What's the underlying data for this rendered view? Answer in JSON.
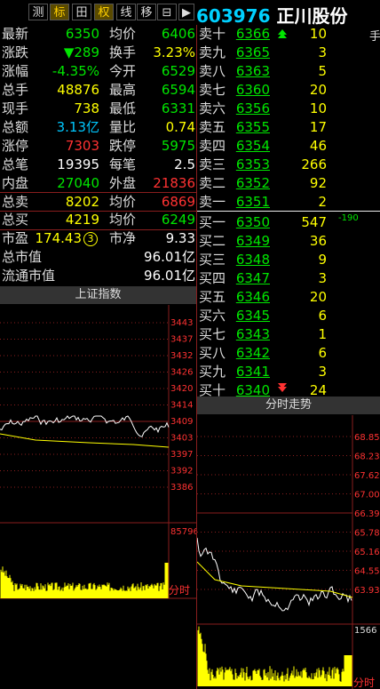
{
  "toolbar": {
    "buttons": [
      {
        "label": "测",
        "name": "tab-ce"
      },
      {
        "label": "标",
        "name": "tab-biao"
      },
      {
        "label": "田",
        "name": "tab-grid"
      },
      {
        "label": "权",
        "name": "tab-quan"
      },
      {
        "label": "线",
        "name": "tab-xian"
      },
      {
        "label": "移",
        "name": "tab-yi"
      },
      {
        "label": "⊟",
        "name": "tab-box"
      },
      {
        "label": "▶",
        "name": "tab-play"
      }
    ],
    "stock_code": "603976",
    "stock_name": "正川股份"
  },
  "quote": {
    "zuixin": {
      "label": "最新",
      "value": "6350"
    },
    "junjia": {
      "label": "均价",
      "value": "6406"
    },
    "zhangdie": {
      "label": "涨跌",
      "value": "▼289"
    },
    "huanshou": {
      "label": "换手",
      "value": "3.23%"
    },
    "zhangfu": {
      "label": "涨幅",
      "value": "-4.35%"
    },
    "jinkai": {
      "label": "今开",
      "value": "6529"
    },
    "zongshou": {
      "label": "总手",
      "value": "48876"
    },
    "zuigao": {
      "label": "最高",
      "value": "6594"
    },
    "xianshou": {
      "label": "现手",
      "value": "738"
    },
    "zuidi": {
      "label": "最低",
      "value": "6331"
    },
    "zonge": {
      "label": "总额",
      "value": "3.13亿"
    },
    "liangbi": {
      "label": "量比",
      "value": "0.74"
    },
    "zhangting": {
      "label": "涨停",
      "value": "7303"
    },
    "dieting": {
      "label": "跌停",
      "value": "5975"
    },
    "zongbi": {
      "label": "总笔",
      "value": "19395"
    },
    "meibi": {
      "label": "每笔",
      "value": "2.5"
    },
    "neipan": {
      "label": "内盘",
      "value": "27040"
    },
    "waipan": {
      "label": "外盘",
      "value": "21836"
    },
    "zongmai": {
      "label": "总卖",
      "value": "8202"
    },
    "junjia2": {
      "label": "均价",
      "value": "6869"
    },
    "zongmaibuy": {
      "label": "总买",
      "value": "4219"
    },
    "junjia3": {
      "label": "均价",
      "value": "6249"
    },
    "shiying": {
      "label": "市盈",
      "value": "174.43"
    },
    "shiying_badge": "3",
    "shijing": {
      "label": "市净",
      "value": "9.33"
    },
    "zongshizhi": {
      "label": "总市值",
      "value": "96.01亿"
    },
    "liutong": {
      "label": "流通市值",
      "value": "96.01亿"
    }
  },
  "orderbook": {
    "sells": [
      {
        "label": "卖十",
        "price": "6366",
        "vol": "10"
      },
      {
        "label": "卖九",
        "price": "6365",
        "vol": "3"
      },
      {
        "label": "卖八",
        "price": "6363",
        "vol": "5"
      },
      {
        "label": "卖七",
        "price": "6360",
        "vol": "20"
      },
      {
        "label": "卖六",
        "price": "6356",
        "vol": "10"
      },
      {
        "label": "卖五",
        "price": "6355",
        "vol": "17"
      },
      {
        "label": "卖四",
        "price": "6354",
        "vol": "46"
      },
      {
        "label": "卖三",
        "price": "6353",
        "vol": "266"
      },
      {
        "label": "卖二",
        "price": "6352",
        "vol": "92"
      },
      {
        "label": "卖一",
        "price": "6351",
        "vol": "2"
      }
    ],
    "buys": [
      {
        "label": "买一",
        "price": "6350",
        "vol": "547"
      },
      {
        "label": "买二",
        "price": "6349",
        "vol": "36"
      },
      {
        "label": "买三",
        "price": "6348",
        "vol": "9"
      },
      {
        "label": "买四",
        "price": "6347",
        "vol": "3"
      },
      {
        "label": "买五",
        "price": "6346",
        "vol": "20"
      },
      {
        "label": "买六",
        "price": "6345",
        "vol": "6"
      },
      {
        "label": "买七",
        "price": "6343",
        "vol": "1"
      },
      {
        "label": "买八",
        "price": "6342",
        "vol": "6"
      },
      {
        "label": "买九",
        "price": "6341",
        "vol": "3"
      },
      {
        "label": "买十",
        "price": "6340",
        "vol": "24"
      }
    ],
    "side_label": "手",
    "buy1_change": "-190"
  },
  "index_chart": {
    "title": "上证指数",
    "price_ticks": [
      "3443",
      "3437",
      "3432",
      "3426",
      "3420",
      "3414",
      "3409",
      "3403",
      "3397",
      "3392",
      "3386"
    ],
    "vol_tick": "85796",
    "time_label": "分时"
  },
  "stock_chart": {
    "title": "分时走势",
    "price_ticks": [
      "68.85",
      "68.23",
      "67.62",
      "67.00",
      "66.39",
      "65.78",
      "65.16",
      "64.55",
      "63.93"
    ],
    "vol_tick": "1566",
    "time_label": "分时"
  },
  "colors": {
    "up": "#ff3232",
    "down": "#00e600",
    "accent": "#ffff00",
    "grid": "#8a1e1e"
  }
}
